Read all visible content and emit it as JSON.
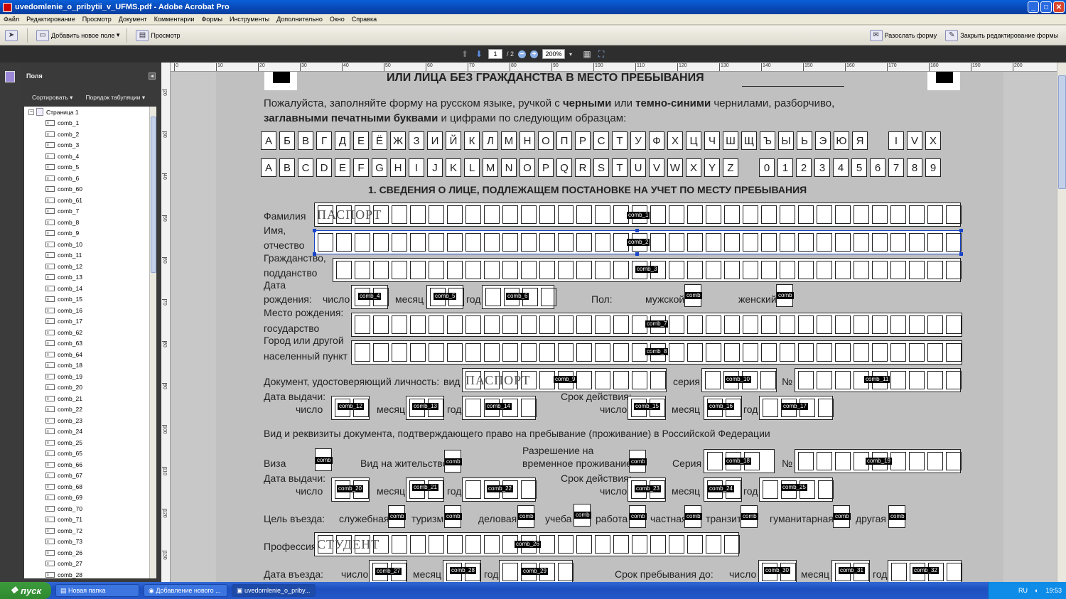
{
  "window": {
    "title": "uvedomlenie_o_pribytii_v_UFMS.pdf - Adobe Acrobat Pro"
  },
  "menu": [
    "Файл",
    "Редактирование",
    "Просмотр",
    "Документ",
    "Комментарии",
    "Формы",
    "Инструменты",
    "Дополнительно",
    "Окно",
    "Справка"
  ],
  "toolbar": {
    "add_field": "Добавить новое поле",
    "preview": "Просмотр",
    "distribute": "Разослать форму",
    "close_edit": "Закрыть редактирование формы"
  },
  "nav": {
    "page": "1",
    "pages": "/ 2",
    "zoom": "200%"
  },
  "fields_panel": {
    "title": "Поля",
    "sort": "Сортировать",
    "tab_order": "Порядок табуляции",
    "page_node": "Страница 1",
    "items": [
      "comb_1",
      "comb_2",
      "comb_3",
      "comb_4",
      "comb_5",
      "comb_6",
      "comb_60",
      "comb_61",
      "comb_7",
      "comb_8",
      "comb_9",
      "comb_10",
      "comb_11",
      "comb_12",
      "comb_13",
      "comb_14",
      "comb_15",
      "comb_16",
      "comb_17",
      "comb_62",
      "comb_63",
      "comb_64",
      "comb_18",
      "comb_19",
      "comb_20",
      "comb_21",
      "comb_22",
      "comb_23",
      "comb_24",
      "comb_25",
      "comb_65",
      "comb_66",
      "comb_67",
      "comb_68",
      "comb_69",
      "comb_70",
      "comb_71",
      "comb_72",
      "comb_73",
      "comb_26",
      "comb_27",
      "comb_28"
    ]
  },
  "ruler_h": [
    "0",
    "10",
    "20",
    "30",
    "40",
    "50",
    "60",
    "70",
    "80",
    "90",
    "100",
    "110",
    "120",
    "130",
    "140",
    "150",
    "160",
    "170",
    "180",
    "190",
    "200"
  ],
  "ruler_v": [
    "20",
    "30",
    "40",
    "50",
    "60",
    "70",
    "80",
    "90",
    "100",
    "110",
    "120",
    "130"
  ],
  "form": {
    "heading_top": "ИЛИ ЛИЦА БЕЗ ГРАЖДАНСТВА В МЕСТО ПРЕБЫВАНИЯ",
    "instr_1a": "Пожалуйста, заполняйте форму на русском языке, ручкой с ",
    "instr_1b": "черными",
    "instr_1c": " или ",
    "instr_1d": "темно-синими",
    "instr_1e": " чернилами, разборчиво,",
    "instr_2a": "заглавными печатными буквами",
    "instr_2b": " и цифрами по следующим образцам:",
    "cyr": [
      "А",
      "Б",
      "В",
      "Г",
      "Д",
      "Е",
      "Ё",
      "Ж",
      "З",
      "И",
      "Й",
      "К",
      "Л",
      "М",
      "Н",
      "О",
      "П",
      "Р",
      "С",
      "Т",
      "У",
      "Ф",
      "Х",
      "Ц",
      "Ч",
      "Ш",
      "Щ",
      "Ъ",
      "Ы",
      "Ь",
      "Э",
      "Ю",
      "Я"
    ],
    "roman": [
      "I",
      "V",
      "X"
    ],
    "lat": [
      "A",
      "B",
      "C",
      "D",
      "E",
      "F",
      "G",
      "H",
      "I",
      "J",
      "K",
      "L",
      "M",
      "N",
      "O",
      "P",
      "Q",
      "R",
      "S",
      "T",
      "U",
      "V",
      "W",
      "X",
      "Y",
      "Z"
    ],
    "digits": [
      "0",
      "1",
      "2",
      "3",
      "4",
      "5",
      "6",
      "7",
      "8",
      "9"
    ],
    "section1": "1. СВЕДЕНИЯ О ЛИЦЕ, ПОДЛЕЖАЩЕМ ПОСТАНОВКЕ НА УЧЕТ ПО МЕСТУ ПРЕБЫВАНИЯ",
    "surname": "Фамилия",
    "name1": "Имя,",
    "name2": "отчество",
    "cit1": "Гражданство,",
    "cit2": "подданство",
    "dob1": "Дата",
    "dob2": "рождения:",
    "day": "число",
    "month": "месяц",
    "year": "год",
    "sex": "Пол:",
    "male": "мужской",
    "female": "женский",
    "pob": "Место рождения:",
    "state": "государство",
    "city1": "Город или другой",
    "city2": "населенный пункт",
    "iddoc": "Документ, удостоверяющий личность:",
    "kind": "вид",
    "series": "серия",
    "no": "№",
    "issue": "Дата выдачи:",
    "validity": "Срок действия:",
    "rightdoc": "Вид и реквизиты документа, подтверждающего право на пребывание (проживание) в Российской Федерации",
    "visa": "Виза",
    "residence": "Вид на жительство",
    "temp1": "Разрешение на",
    "temp2": "временное проживание",
    "series2": "Серия",
    "purpose": "Цель въезда:",
    "p_service": "служебная",
    "p_tourism": "туризм",
    "p_business": "деловая",
    "p_study": "учеба",
    "p_work": "работа",
    "p_private": "частная",
    "p_transit": "транзит",
    "p_human": "гуманитарная",
    "p_other": "другая",
    "profession": "Профессия",
    "entry": "Дата въезда:",
    "stay_until": "Срок пребывания до:",
    "prefill_passport": "ПАСПОРТ",
    "prefill_student": "СТУДЕНТ",
    "comb": "comb",
    "c1": "comb_1",
    "c2": "comb_2",
    "c3": "comb_3",
    "c4": "comb_4",
    "c5": "comb_5",
    "c6": "comb_6",
    "c7": "comb_7",
    "c8": "comb_8",
    "c9": "comb_9",
    "c10": "comb_10",
    "c11": "comb_11",
    "c12": "comb_12",
    "c13": "comb_13",
    "c14": "comb_14",
    "c15": "comb_15",
    "c16": "comb_16",
    "c17": "comb_17",
    "c18": "comb_18",
    "c19": "comb_19",
    "c20": "comb_20",
    "c21": "comb_21",
    "c22": "comb_22",
    "c23": "comb_23",
    "c24": "comb_24",
    "c25": "comb_25",
    "c26": "comb_26",
    "c27": "comb_27",
    "c28": "comb_28",
    "c29": "comb_29",
    "c30": "comb_30",
    "c31": "comb_31",
    "c32": "comb_32"
  },
  "taskbar": {
    "start": "пуск",
    "tasks": [
      "Новая папка",
      "Добавление нового ...",
      "uvedomlenie_o_priby..."
    ],
    "lang": "RU",
    "time": "19:53"
  }
}
